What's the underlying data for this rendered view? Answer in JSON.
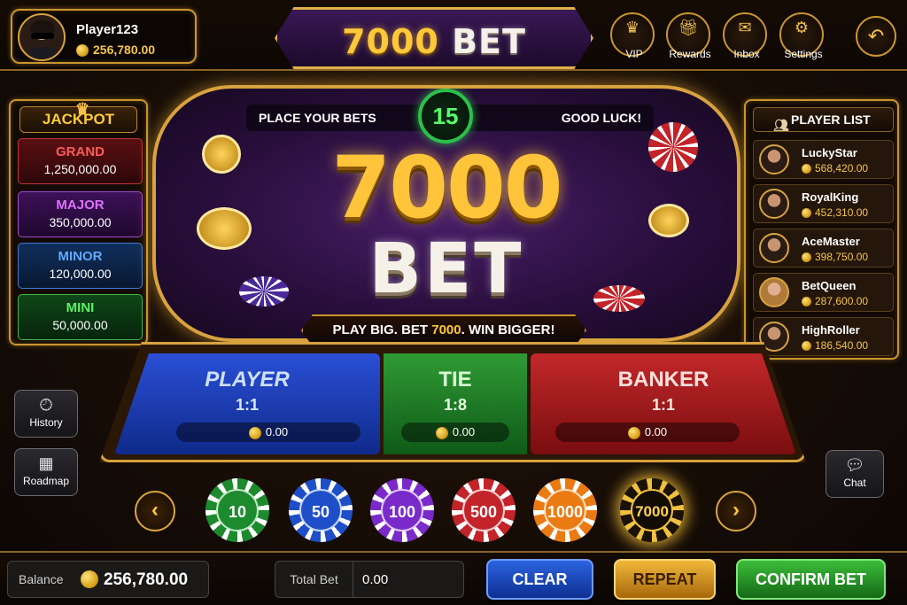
{
  "player": {
    "name": "Player123",
    "balance": "256,780.00"
  },
  "logo": {
    "part1": "7000",
    "part2": "BET"
  },
  "top_nav": [
    {
      "label": "VIP",
      "icon": "crown-icon"
    },
    {
      "label": "Rewards",
      "icon": "gift-icon"
    },
    {
      "label": "Inbox",
      "icon": "envelope-icon"
    },
    {
      "label": "Settings",
      "icon": "gear-icon"
    }
  ],
  "back_icon": "back-arrow-icon",
  "jackpot": {
    "title": "JACKPOT",
    "tiers": [
      {
        "name": "GRAND",
        "value": "1,250,000.00",
        "color": "#ff5a5a"
      },
      {
        "name": "MAJOR",
        "value": "350,000.00",
        "color": "#e070ff"
      },
      {
        "name": "MINOR",
        "value": "120,000.00",
        "color": "#5fa8ff"
      },
      {
        "name": "MINI",
        "value": "50,000.00",
        "color": "#5cf06a"
      }
    ]
  },
  "board": {
    "left_text": "PLACE YOUR BETS",
    "right_text": "GOOD LUCK!",
    "timer": "15",
    "big_number": "7000",
    "big_word": "BET",
    "tagline_pre": "PLAY BIG. BET ",
    "tagline_hl": "7000",
    "tagline_post": ". WIN BIGGER!"
  },
  "player_list": {
    "title": "PLAYER LIST",
    "players": [
      {
        "name": "LuckyStar",
        "balance": "568,420.00"
      },
      {
        "name": "RoyalKing",
        "balance": "452,310.00"
      },
      {
        "name": "AceMaster",
        "balance": "398,750.00"
      },
      {
        "name": "BetQueen",
        "balance": "287,600.00"
      },
      {
        "name": "HighRoller",
        "balance": "186,540.00"
      }
    ]
  },
  "bet_zones": [
    {
      "name": "PLAYER",
      "odds": "1:1",
      "bet": "0.00",
      "color": "#2a4fd6"
    },
    {
      "name": "TIE",
      "odds": "1:8",
      "bet": "0.00",
      "color": "#2f9a34"
    },
    {
      "name": "BANKER",
      "odds": "1:1",
      "bet": "0.00",
      "color": "#c2282a"
    }
  ],
  "side_buttons": {
    "history": "History",
    "roadmap": "Roadmap",
    "chat": "Chat"
  },
  "chips": [
    "10",
    "50",
    "100",
    "500",
    "1000",
    "7000"
  ],
  "selected_chip": "7000",
  "bottom": {
    "balance_label": "Balance",
    "balance_value": "256,780.00",
    "total_bet_label": "Total Bet",
    "total_bet_value": "0.00",
    "clear": "CLEAR",
    "repeat": "REPEAT",
    "confirm": "CONFIRM BET"
  }
}
